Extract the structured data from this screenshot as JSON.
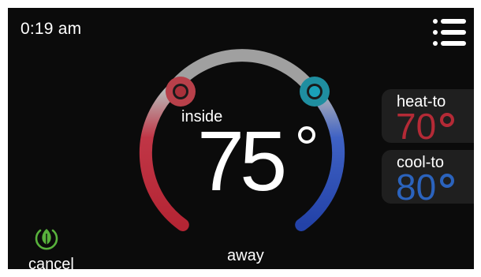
{
  "status": {
    "time": "0:19 am"
  },
  "dial": {
    "label": "inside",
    "temperature": "75",
    "heat_color": "#c8323c",
    "cool_color": "#2e52b8",
    "track_color": "#9a9a9a"
  },
  "setpoints": {
    "heat": {
      "label": "heat-to",
      "value": "70",
      "color": "#b42a36"
    },
    "cool": {
      "label": "cool-to",
      "value": "80",
      "color": "#2b63bd"
    }
  },
  "footer": {
    "cancel_label": "cancel",
    "mode_label": "away",
    "leaf_color": "#58b23c"
  },
  "icons": {
    "menu": "menu-list-icon",
    "leaf": "leaf-icon",
    "heat_handle": "heat-setpoint-handle",
    "cool_handle": "cool-setpoint-handle"
  }
}
